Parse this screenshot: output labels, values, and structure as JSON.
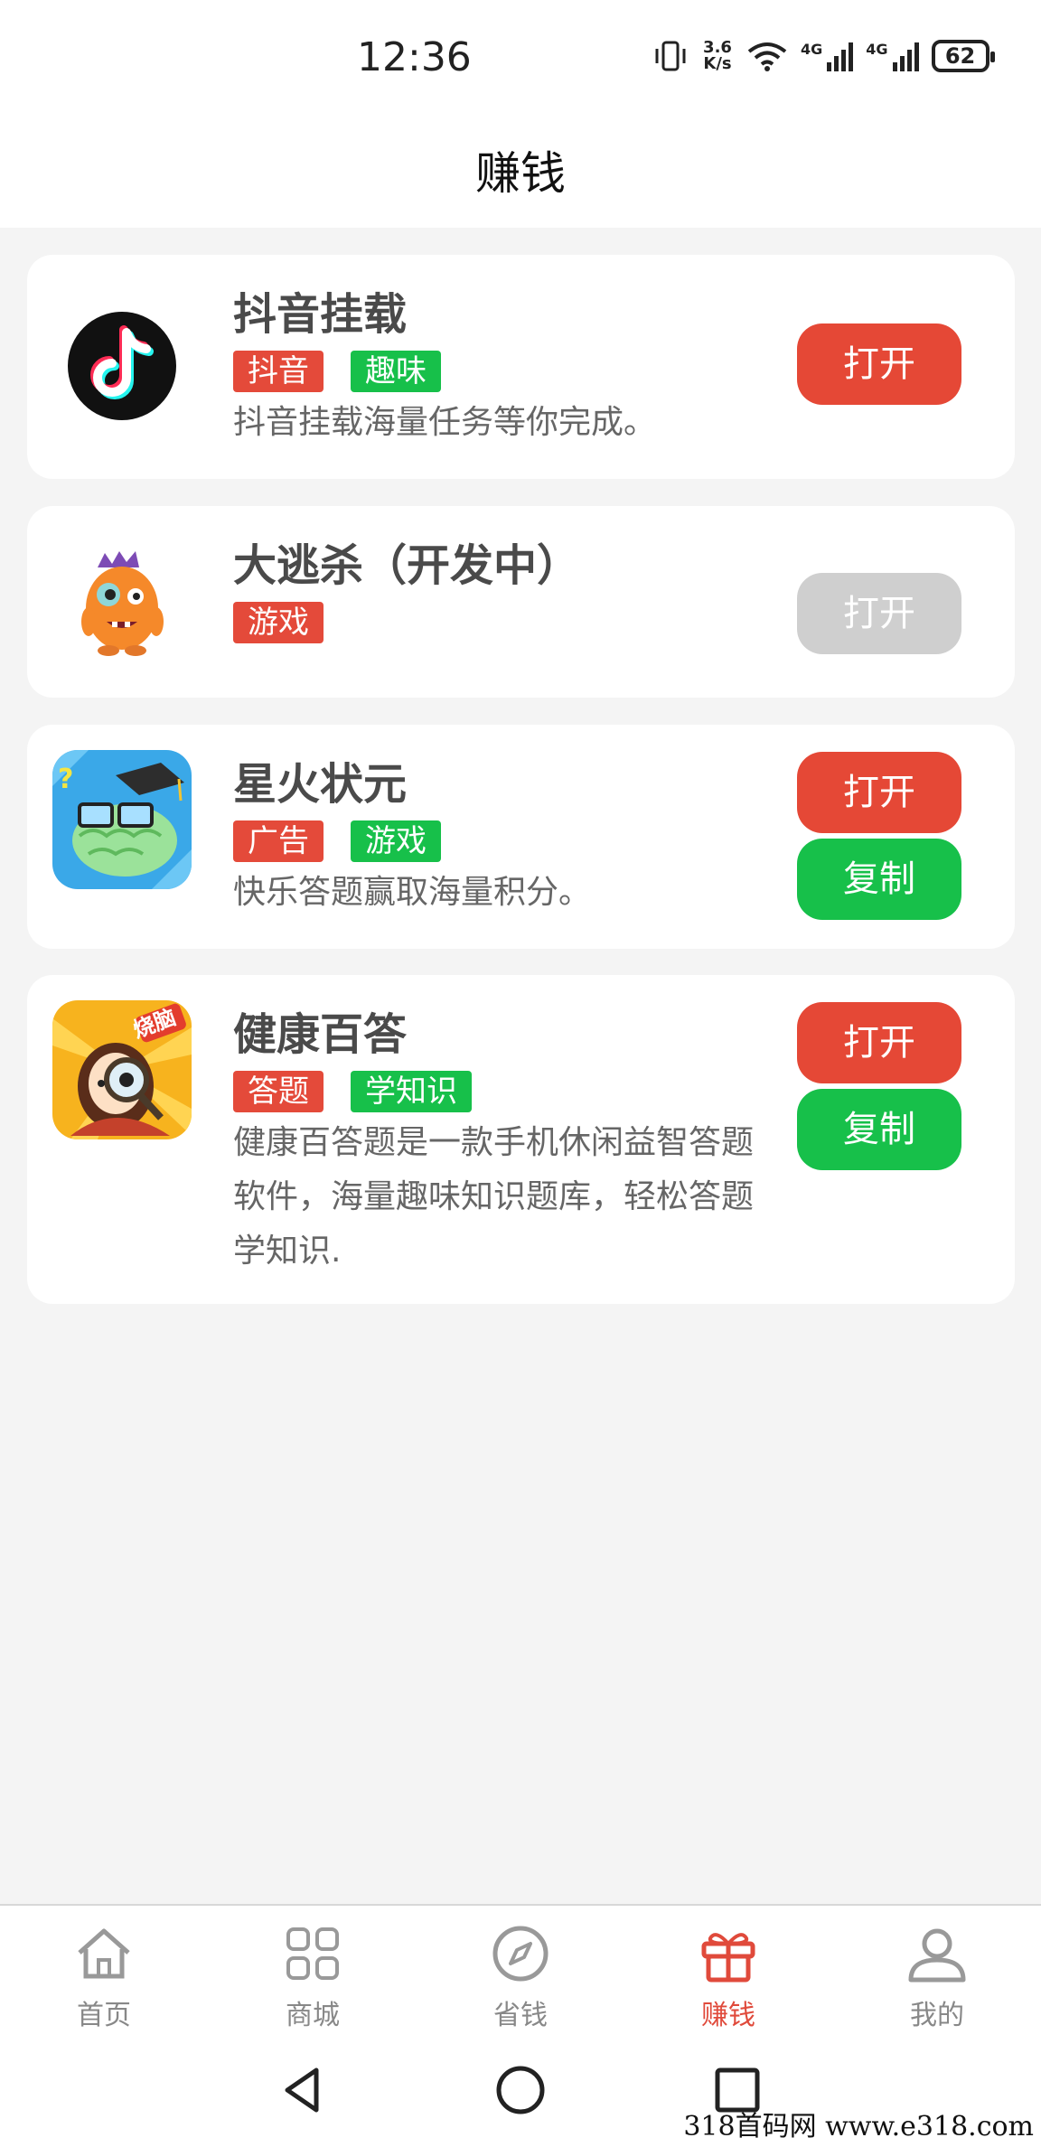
{
  "status_bar": {
    "time": "12:36",
    "speed_value": "3.6",
    "speed_unit": "K/s",
    "network_1": "4G",
    "network_2": "4G",
    "battery": "62"
  },
  "header": {
    "title": "赚钱"
  },
  "tasks": [
    {
      "title": "抖音挂载",
      "tags": [
        {
          "label": "抖音",
          "color": "#e44a3a"
        },
        {
          "label": "趣味",
          "color": "#17c04a"
        }
      ],
      "description": "抖音挂载海量任务等你完成。",
      "open_label": "打开",
      "open_enabled": true,
      "icon": "tiktok-logo-icon"
    },
    {
      "title": "大逃杀（开发中）",
      "tags": [
        {
          "label": "游戏",
          "color": "#e44a3a"
        }
      ],
      "description": "",
      "open_label": "打开",
      "open_enabled": false,
      "icon": "orange-monster-icon"
    },
    {
      "title": "星火状元",
      "tags": [
        {
          "label": "广告",
          "color": "#e44a3a"
        },
        {
          "label": "游戏",
          "color": "#17c04a"
        }
      ],
      "description": "快乐答题赢取海量积分。",
      "open_label": "打开",
      "copy_label": "复制",
      "open_enabled": true,
      "icon": "brain-graduate-icon"
    },
    {
      "title": "健康百答",
      "tags": [
        {
          "label": "答题",
          "color": "#e44a3a"
        },
        {
          "label": "学知识",
          "color": "#17c04a"
        }
      ],
      "description": "健康百答题是一款手机休闲益智答题软件，海量趣味知识题库，轻松答题学知识.",
      "open_label": "打开",
      "copy_label": "复制",
      "open_enabled": true,
      "icon": "magnifier-girl-icon",
      "icon_badge": "烧脑"
    }
  ],
  "tabbar": {
    "active": "赚钱",
    "items": [
      {
        "label": "首页",
        "icon": "home-icon"
      },
      {
        "label": "商城",
        "icon": "grid-icon"
      },
      {
        "label": "省钱",
        "icon": "compass-icon"
      },
      {
        "label": "赚钱",
        "icon": "gift-icon"
      },
      {
        "label": "我的",
        "icon": "user-icon"
      }
    ]
  },
  "nav": {
    "buttons": [
      "back-icon",
      "home-circle-icon",
      "recents-icon"
    ]
  },
  "watermark": "318首码网 www.e318.com",
  "colors": {
    "accent_red": "#e54836",
    "accent_green": "#17c04a",
    "disabled": "#cfcfcf",
    "tab_active": "#e04a3b"
  }
}
